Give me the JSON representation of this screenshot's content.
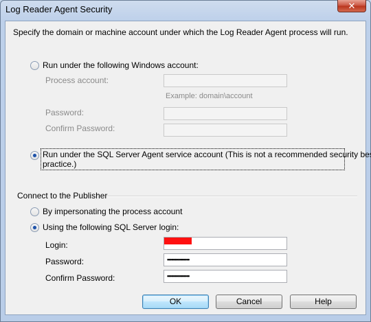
{
  "window": {
    "title": "Log Reader Agent Security",
    "close_label": "✕"
  },
  "intro_text": "Specify the domain or machine account under which the Log Reader Agent process will run.",
  "windows_account": {
    "radio_label": "Run under the following Windows account:",
    "selected": false,
    "process_account_label": "Process account:",
    "process_account_value": "",
    "example_text": "Example: domain\\account",
    "password_label": "Password:",
    "password_value": "",
    "confirm_password_label": "Confirm Password:",
    "confirm_password_value": ""
  },
  "agent_service": {
    "radio_label_line1": "Run under the SQL Server Agent service account (This is not a recommended security best",
    "radio_label_line2": "practice.)",
    "selected": true
  },
  "publisher": {
    "group_label": "Connect to the Publisher",
    "impersonate_label": "By impersonating the process account",
    "impersonate_selected": false,
    "sql_login_label": "Using the following SQL Server login:",
    "sql_login_selected": true,
    "login_label": "Login:",
    "login_value_redacted": true,
    "password_label": "Password:",
    "password_value": "•••••••••••••••",
    "confirm_password_label": "Confirm Password:",
    "confirm_password_value": "•••••••••••••••"
  },
  "buttons": {
    "ok": "OK",
    "cancel": "Cancel",
    "help": "Help"
  },
  "colors": {
    "selected_dot": "#1f52a8",
    "redaction": "#ff1010",
    "close_button": "#c9513d"
  }
}
